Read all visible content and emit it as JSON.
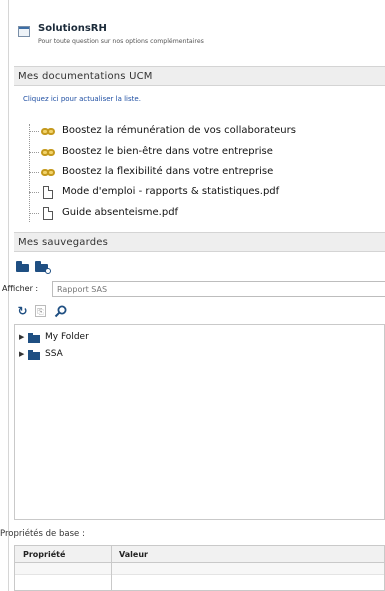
{
  "promo": {
    "title": "SolutionsRH",
    "subtitle": "Pour toute question sur nos options complémentaires"
  },
  "docs": {
    "header": "Mes documentations UCM",
    "refresh_link": "Cliquez ici pour actualiser la liste.",
    "items": [
      {
        "label": "Boostez la rémunération de vos collaborateurs",
        "icon": "link-icon"
      },
      {
        "label": "Boostez le bien-être dans votre entreprise",
        "icon": "link-icon"
      },
      {
        "label": "Boostez la flexibilité dans votre entreprise",
        "icon": "link-icon"
      },
      {
        "label": "Mode d'emploi - rapports & statistiques.pdf",
        "icon": "file-icon"
      },
      {
        "label": "Guide absenteisme.pdf",
        "icon": "file-icon"
      }
    ]
  },
  "saves": {
    "header": "Mes sauvegardes",
    "filter_label": "Afficher :",
    "filter_placeholder": "Rapport SAS",
    "folders": [
      {
        "name": "My Folder"
      },
      {
        "name": "SSA"
      }
    ],
    "props_label": "Propriétés de base :",
    "props_columns": [
      "Propriété",
      "Valeur"
    ]
  },
  "colors": {
    "folder": "#1f4f82",
    "link": "#1f4fa3",
    "header_bg": "#eeeeee"
  }
}
